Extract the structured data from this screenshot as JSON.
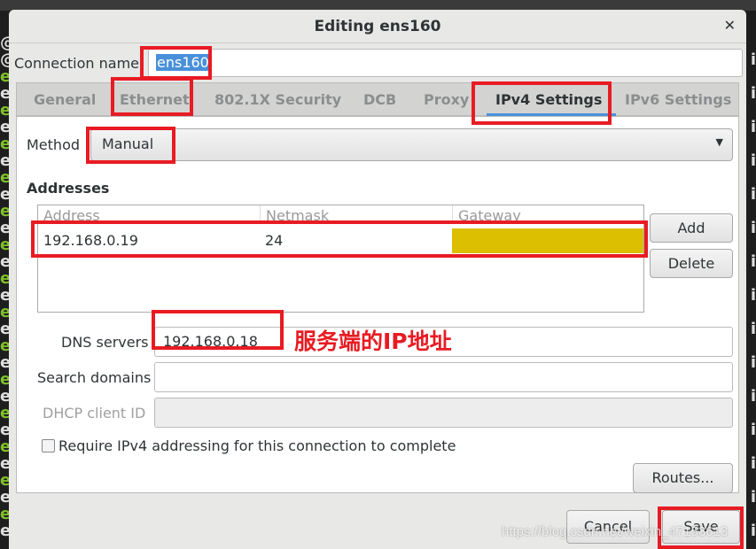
{
  "window": {
    "title": "Editing ens160"
  },
  "connection_name": {
    "label": "Connection name",
    "value": "ens160"
  },
  "tabs": [
    {
      "label": "General"
    },
    {
      "label": "Ethernet"
    },
    {
      "label": "802.1X Security"
    },
    {
      "label": "DCB"
    },
    {
      "label": "Proxy"
    },
    {
      "label": "IPv4 Settings",
      "active": true
    },
    {
      "label": "IPv6 Settings"
    }
  ],
  "method": {
    "label": "Method",
    "value": "Manual"
  },
  "addresses": {
    "heading": "Addresses",
    "columns": [
      "Address",
      "Netmask",
      "Gateway"
    ],
    "rows": [
      {
        "address": "192.168.0.19",
        "netmask": "24",
        "gateway": ""
      }
    ],
    "add_label": "Add",
    "delete_label": "Delete"
  },
  "dns": {
    "label": "DNS servers",
    "value": "192.168.0.18",
    "annotation": "服务端的IP地址"
  },
  "search_domains": {
    "label": "Search domains",
    "value": ""
  },
  "dhcp_client_id": {
    "label": "DHCP client ID",
    "value": ""
  },
  "require_ipv4": {
    "label": "Require IPv4 addressing for this connection to complete",
    "checked": false
  },
  "routes_label": "Routes...",
  "cancel_label": "Cancel",
  "save_label": "Save",
  "watermark": "https://blog.csdn.net/weixin_47153613",
  "colors": {
    "highlight_red": "#e81b23",
    "gateway_fill": "#dcbf00",
    "selection": "#4a90d9"
  }
}
